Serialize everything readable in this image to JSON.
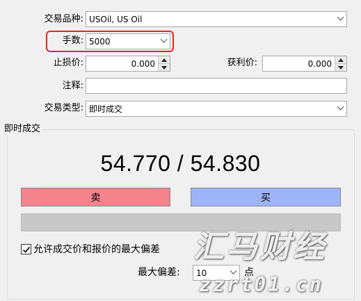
{
  "form": {
    "symbol_label": "交易品种:",
    "symbol_value": "USOil, US Oil",
    "volume_label": "手数:",
    "volume_value": "5000",
    "stop_loss_label": "止损价:",
    "stop_loss_value": "0.000",
    "take_profit_label": "获利价:",
    "take_profit_value": "0.000",
    "comment_label": "注释:",
    "comment_value": "",
    "order_type_label": "交易类型:",
    "order_type_value": "即时成交"
  },
  "execution": {
    "group_title": "即时成交",
    "bid": "54.770",
    "separator": "/",
    "ask": "54.830",
    "sell_label": "卖",
    "buy_label": "买",
    "sell_color": "#f4838b",
    "buy_color": "#9db4f6",
    "deviation_checkbox_label": "允许成交价和报价的最大偏差",
    "deviation_checked": true,
    "max_deviation_label": "最大偏差:",
    "max_deviation_value": "10",
    "points_label": "点"
  },
  "highlight_color": "#e8231e",
  "watermark": {
    "brand": "汇马财经",
    "url": "zzrt01.cn"
  }
}
